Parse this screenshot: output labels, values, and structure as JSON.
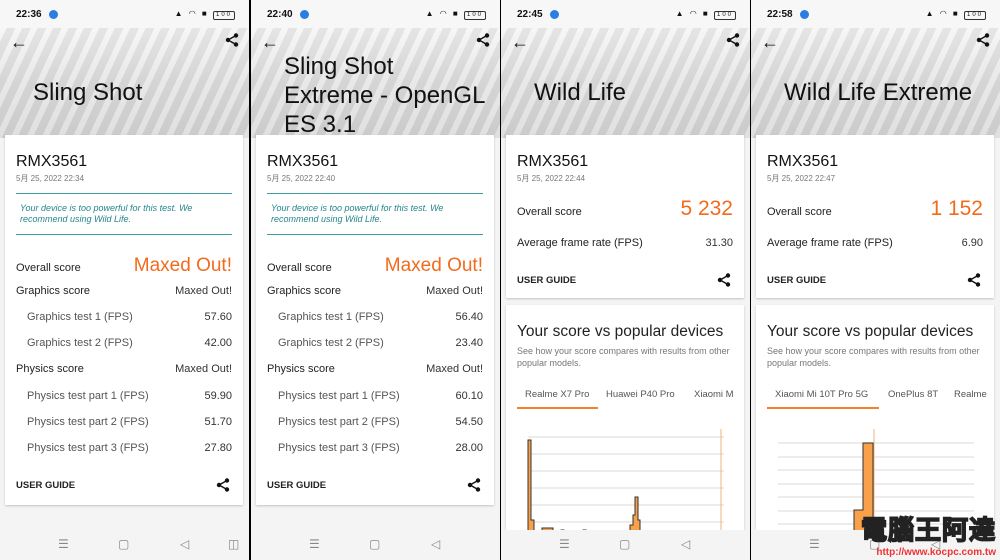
{
  "panels": [
    {
      "time": "22:36",
      "title": "Sling Shot",
      "device": "RMX3561",
      "date": "5月 25, 2022 22:34",
      "notice": "Your device is too powerful for this test. We recommend using Wild Life.",
      "overall_label": "Overall score",
      "overall_value": "Maxed Out!",
      "graphics_label": "Graphics score",
      "graphics_value": "Maxed Out!",
      "gt1_label": "Graphics test 1 (FPS)",
      "gt1_value": "57.60",
      "gt2_label": "Graphics test 2 (FPS)",
      "gt2_value": "42.00",
      "physics_label": "Physics score",
      "physics_value": "Maxed Out!",
      "pt1_label": "Physics test part 1 (FPS)",
      "pt1_value": "59.90",
      "pt2_label": "Physics test part 2 (FPS)",
      "pt2_value": "51.70",
      "pt3_label": "Physics test part 3 (FPS)",
      "pt3_value": "27.80",
      "guide": "USER GUIDE"
    },
    {
      "time": "22:40",
      "title": "Sling Shot Extreme - OpenGL ES 3.1",
      "device": "RMX3561",
      "date": "5月 25, 2022 22:40",
      "notice": "Your device is too powerful for this test. We recommend using Wild Life.",
      "overall_label": "Overall score",
      "overall_value": "Maxed Out!",
      "graphics_label": "Graphics score",
      "graphics_value": "Maxed Out!",
      "gt1_label": "Graphics test 1 (FPS)",
      "gt1_value": "56.40",
      "gt2_label": "Graphics test 2 (FPS)",
      "gt2_value": "23.40",
      "physics_label": "Physics score",
      "physics_value": "Maxed Out!",
      "pt1_label": "Physics test part 1 (FPS)",
      "pt1_value": "60.10",
      "pt2_label": "Physics test part 2 (FPS)",
      "pt2_value": "54.50",
      "pt3_label": "Physics test part 3 (FPS)",
      "pt3_value": "28.00",
      "guide": "USER GUIDE"
    },
    {
      "time": "22:45",
      "title": "Wild Life",
      "device": "RMX3561",
      "date": "5月 25, 2022 22:44",
      "overall_label": "Overall score",
      "overall_value": "5 232",
      "fps_label": "Average frame rate (FPS)",
      "fps_value": "31.30",
      "guide": "USER GUIDE",
      "compare_title": "Your score vs popular devices",
      "compare_desc": "See how your score compares with results from other popular models.",
      "tabs": [
        "Realme X7 Pro",
        "Huawei P40 Pro",
        "Xiaomi M"
      ]
    },
    {
      "time": "22:58",
      "title": "Wild Life Extreme",
      "device": "RMX3561",
      "date": "5月 25, 2022 22:47",
      "overall_label": "Overall score",
      "overall_value": "1 152",
      "fps_label": "Average frame rate (FPS)",
      "fps_value": "6.90",
      "guide": "USER GUIDE",
      "compare_title": "Your score vs popular devices",
      "compare_desc": "See how your score compares with results from other popular models.",
      "tabs": [
        "Xiaomi Mi 10T Pro 5G",
        "OnePlus 8T",
        "Realme"
      ]
    }
  ],
  "watermark": {
    "name": "電腦王阿達",
    "url": "http://www.kocpc.com.tw"
  },
  "colors": {
    "accent": "#f26b1d",
    "notice": "#23868c",
    "bar": "#f9a04b"
  }
}
